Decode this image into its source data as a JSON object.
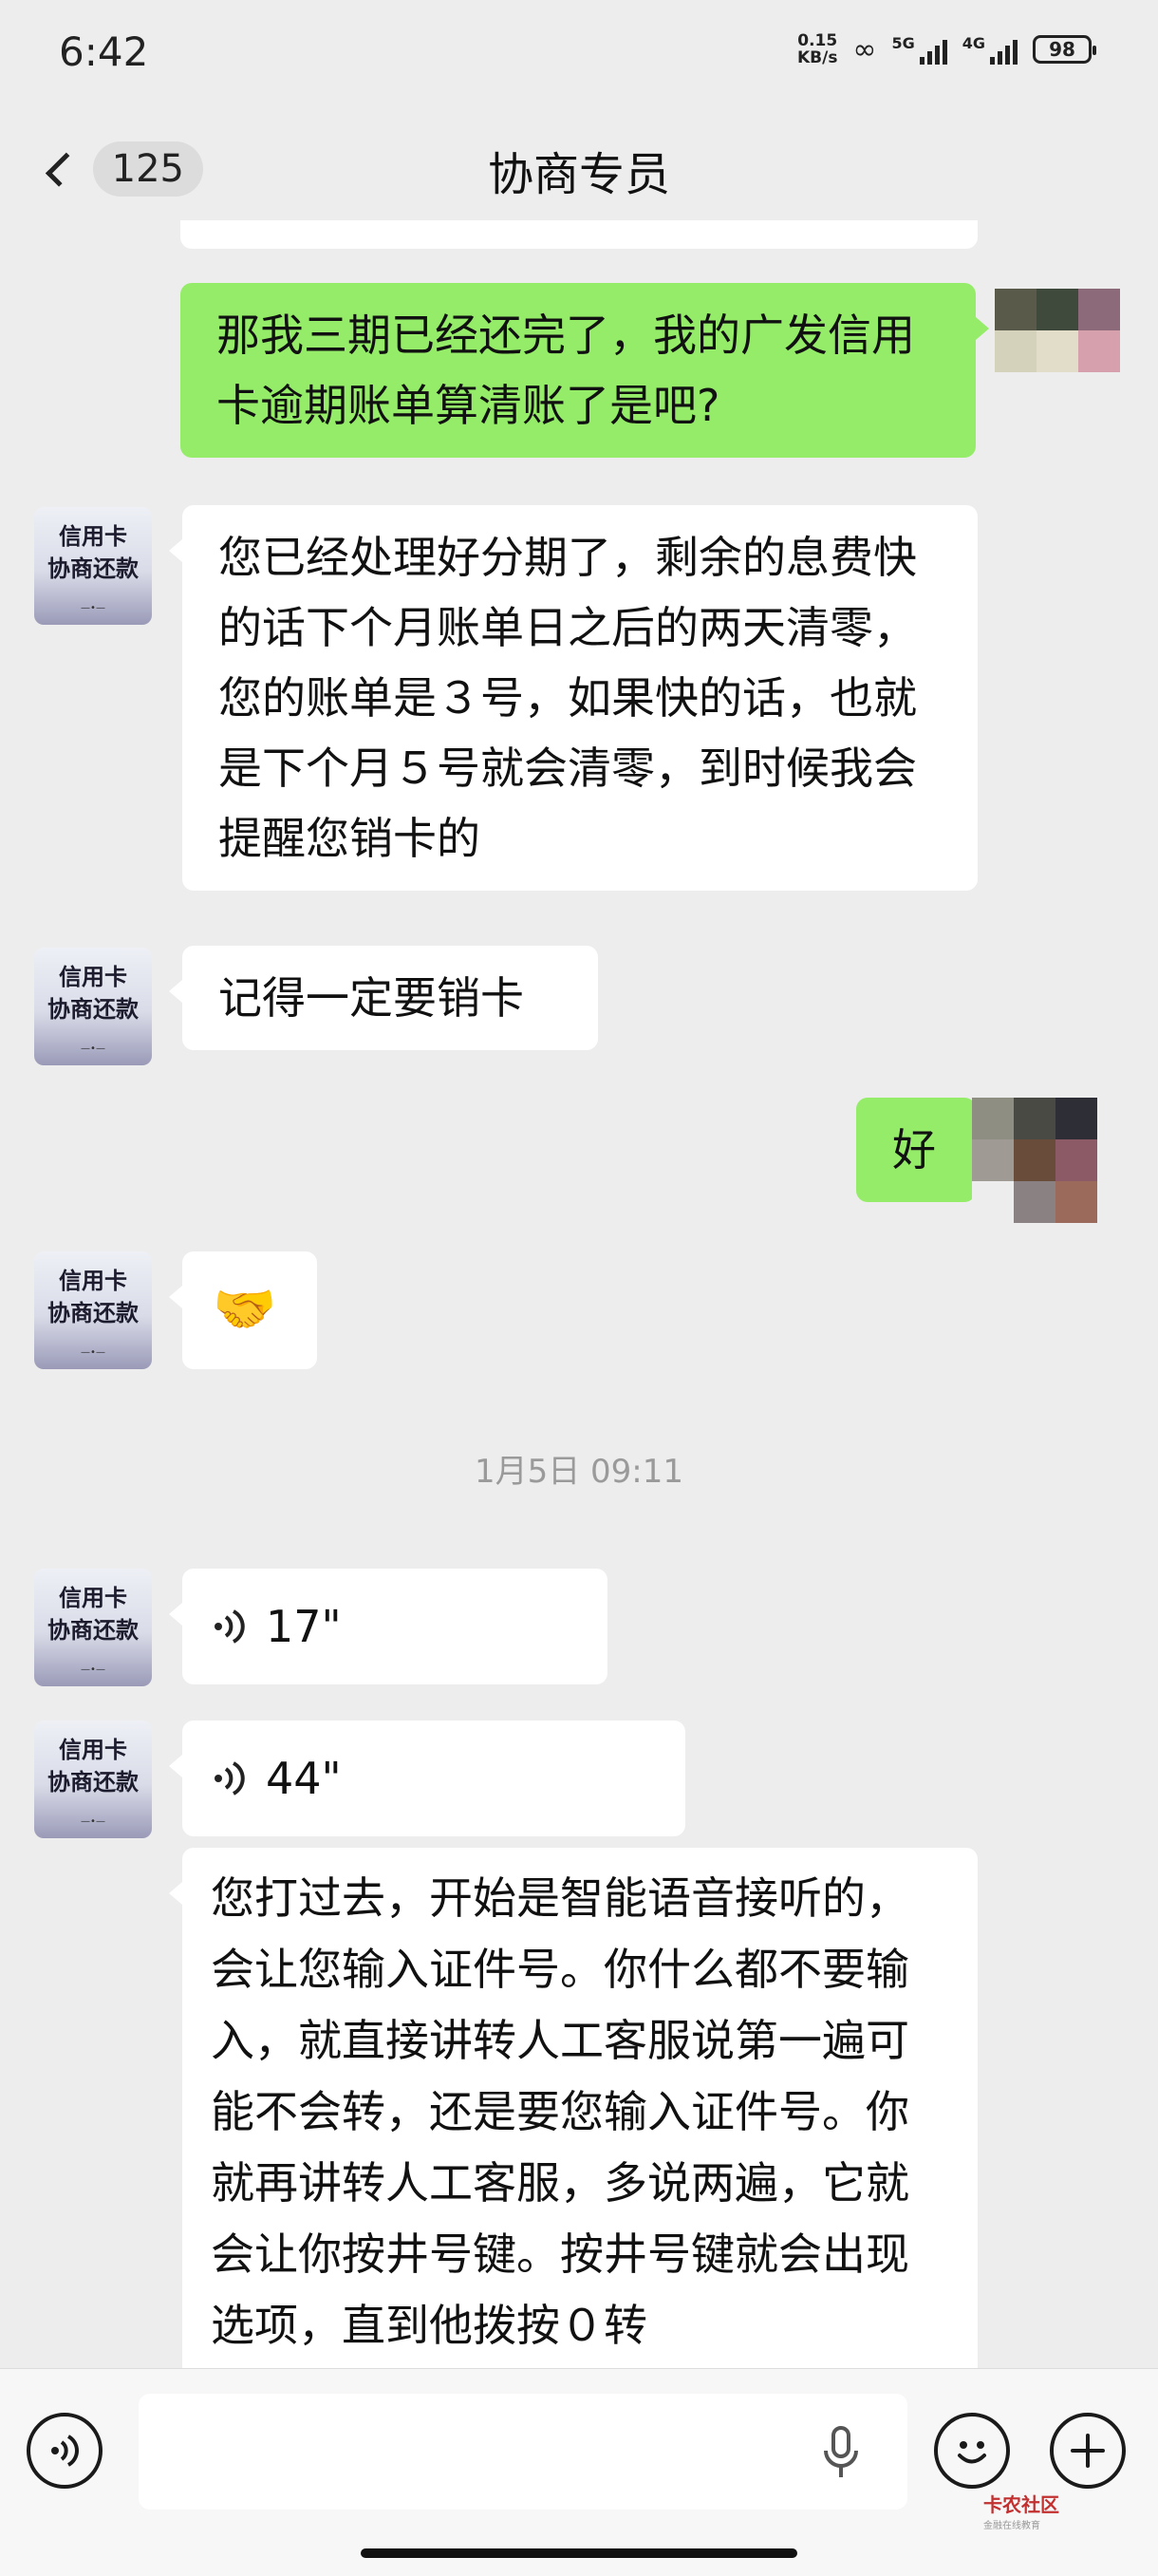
{
  "status_bar": {
    "time": "6:42",
    "net_speed_value": "0.15",
    "net_speed_unit": "KB/s",
    "signal1": "5G",
    "signal2": "4G",
    "battery": "98"
  },
  "header": {
    "unread_count": "125",
    "title": "协商专员"
  },
  "avatar_text": {
    "line1": "信用卡",
    "line2": "协商还款"
  },
  "messages": [
    {
      "from": "me",
      "type": "text",
      "text": "那我三期已经还完了，我的广发信用卡逾期账单算清账了是吧?"
    },
    {
      "from": "agent",
      "type": "text",
      "text": "您已经处理好分期了，剩余的息费快的话下个月账单日之后的两天清零，您的账单是３号，如果快的话，也就是下个月５号就会清零，到时候我会提醒您销卡的"
    },
    {
      "from": "agent",
      "type": "text",
      "text": "记得一定要销卡"
    },
    {
      "from": "me",
      "type": "text",
      "text": "好"
    },
    {
      "from": "agent",
      "type": "emoji",
      "text": "🤝"
    },
    {
      "from": "agent",
      "type": "voice",
      "text": "17\""
    },
    {
      "from": "agent",
      "type": "voice",
      "text": "44\""
    },
    {
      "from": "agent",
      "type": "text",
      "text": "您打过去，开始是智能语音接听的，会让您输入证件号。你什么都不要输入，就直接讲转人工客服说第一遍可能不会转，还是要您输入证件号。你就再讲转人工客服，多说两遍，它就会让你按井号键。按井号键就会出现选项，直到他拨按０转"
    }
  ],
  "timestamp": "1月5日 09:11",
  "input_bar": {
    "placeholder": ""
  },
  "watermark": {
    "text": "卡农社区",
    "sub": "金融在线教育"
  },
  "colors": {
    "bubble_out": "#95ec69",
    "bubble_in": "#ffffff",
    "background": "#ededed"
  },
  "icons": [
    "back-chevron-icon",
    "voice-mode-icon",
    "microphone-icon",
    "emoji-icon",
    "plus-icon"
  ]
}
